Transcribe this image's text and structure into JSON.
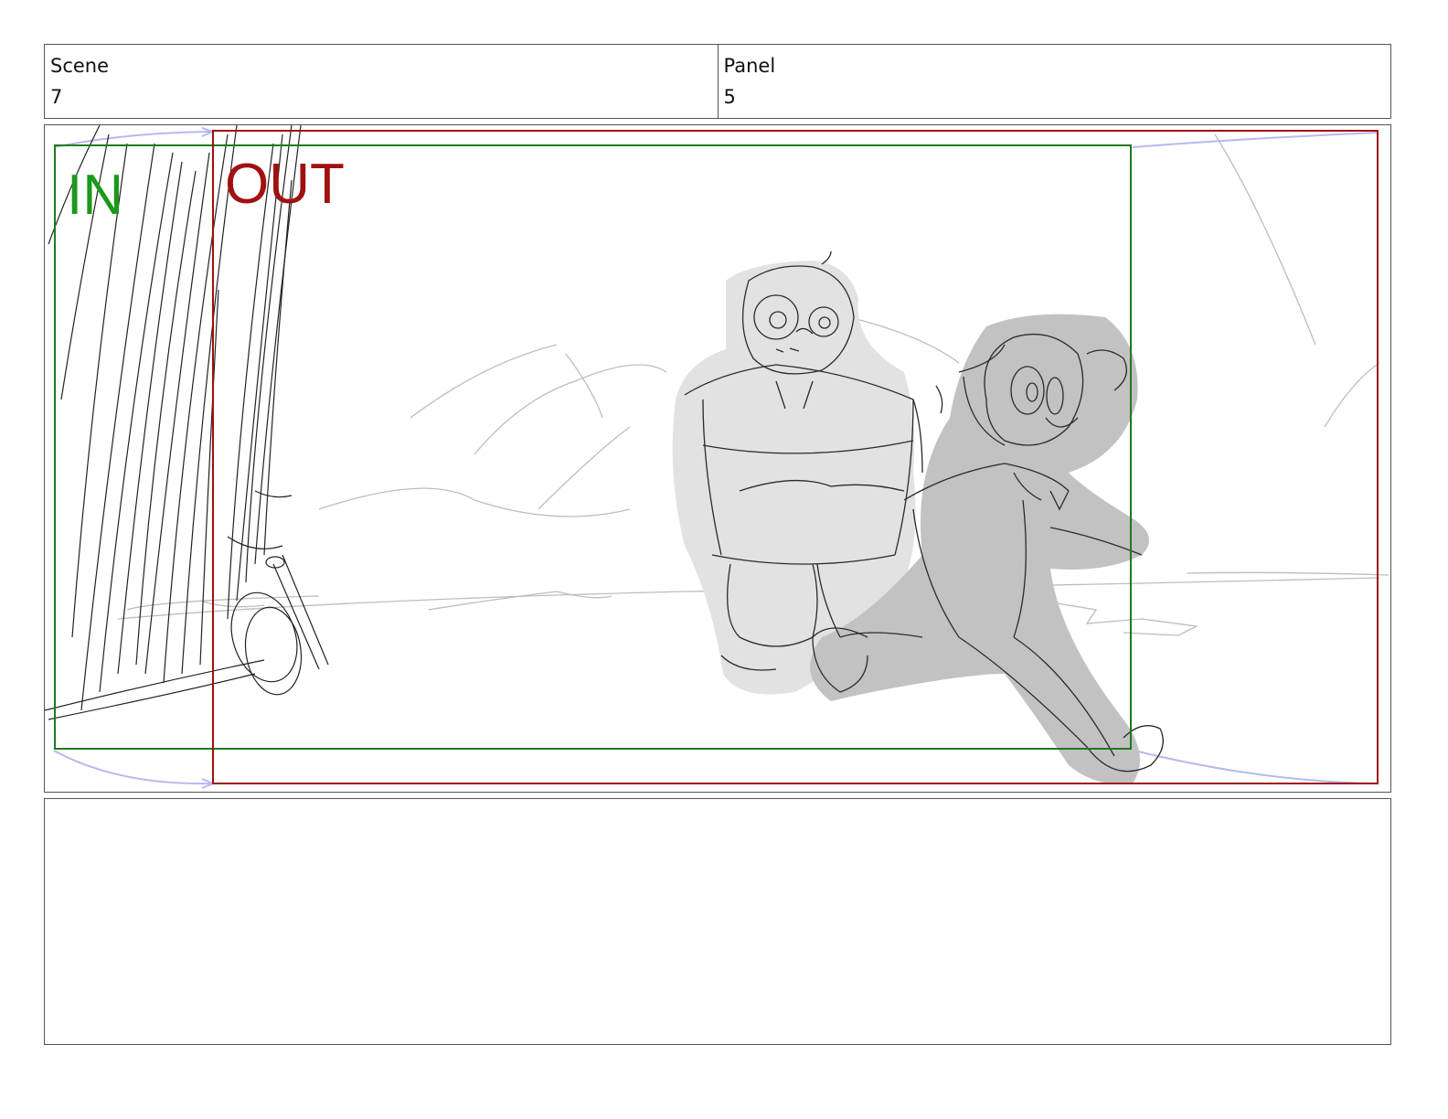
{
  "header": {
    "scene_label": "Scene",
    "scene_value": "7",
    "panel_label": "Panel",
    "panel_value": "5"
  },
  "frame": {
    "in_label": "IN",
    "out_label": "OUT",
    "colors": {
      "in": "#1a9a1a",
      "out": "#a01010",
      "pan_arrow": "#b8b8ee"
    }
  },
  "notes": {
    "text": ""
  }
}
